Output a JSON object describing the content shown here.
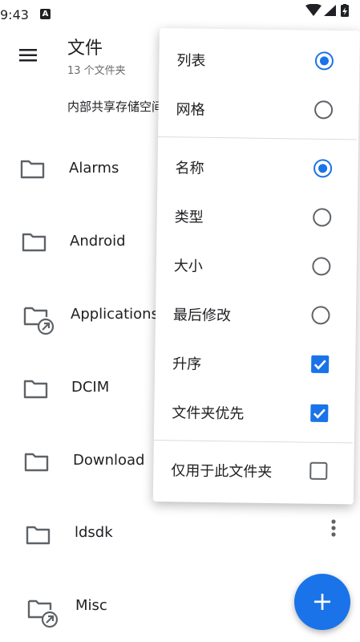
{
  "status_bar": {
    "time": "9:43",
    "notification_badge": "A",
    "icons": [
      "wifi-icon",
      "signal-icon",
      "battery-icon"
    ]
  },
  "app_bar": {
    "title": "文件",
    "subtitle": "13 个文件夹"
  },
  "breadcrumb": "内部共享存储空间",
  "files": [
    {
      "name": "Alarms",
      "icon": "folder-icon"
    },
    {
      "name": "Android",
      "icon": "folder-icon"
    },
    {
      "name": "Applications",
      "icon": "folder-link-icon"
    },
    {
      "name": "DCIM",
      "icon": "folder-icon"
    },
    {
      "name": "Download",
      "icon": "folder-icon"
    },
    {
      "name": "ldsdk",
      "icon": "folder-icon"
    },
    {
      "name": "Misc",
      "icon": "folder-link-icon"
    }
  ],
  "menu": {
    "view": [
      {
        "label": "列表",
        "selected": true
      },
      {
        "label": "网格",
        "selected": false
      }
    ],
    "sort": [
      {
        "label": "名称",
        "selected": true
      },
      {
        "label": "类型",
        "selected": false
      },
      {
        "label": "大小",
        "selected": false
      },
      {
        "label": "最后修改",
        "selected": false
      }
    ],
    "options": [
      {
        "label": "升序",
        "checked": true
      },
      {
        "label": "文件夹优先",
        "checked": true
      }
    ],
    "scope": [
      {
        "label": "仅用于此文件夹",
        "checked": false
      }
    ]
  },
  "fab": {
    "label": "+"
  },
  "colors": {
    "accent": "#1a73e8",
    "text": "#202124",
    "icon": "#5f6368",
    "divider": "#dadce0"
  }
}
